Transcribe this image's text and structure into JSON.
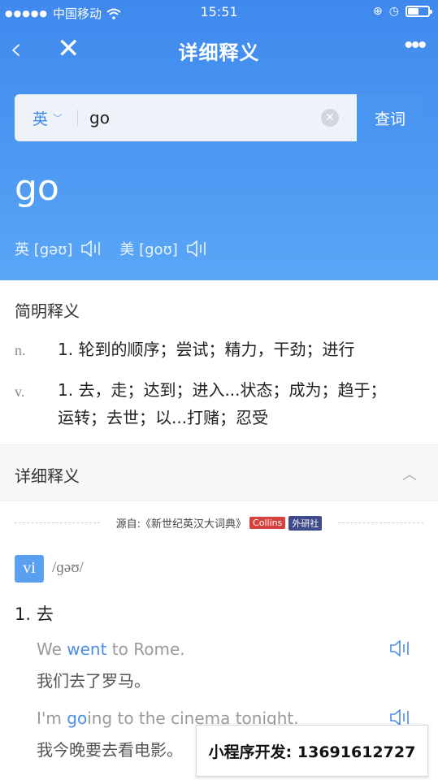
{
  "status_bar": {
    "carrier": "中国移动",
    "time": "15:51",
    "battery_level": 0.55
  },
  "nav": {
    "title": "详细释义",
    "back_icon": "chevron-left-icon",
    "close_icon": "close-icon",
    "more_icon": "more-icon"
  },
  "search": {
    "lang": "英",
    "value": "go",
    "button": "查词"
  },
  "word": {
    "headword": "go",
    "uk_label": "英 [gəʊ]",
    "us_label": "美 [goʊ]"
  },
  "brief": {
    "title": "简明释义",
    "entries": [
      {
        "pos": "n.",
        "text": "1. 轮到的顺序；尝试；精力，干劲；进行"
      },
      {
        "pos": "v.",
        "text": "1. 去，走；达到；进入...状态；成为；趋于；运转；去世；以...打赌；忍受"
      }
    ]
  },
  "detail": {
    "title": "详细释义",
    "source_prefix": "源自:《新世纪英汉大词典》",
    "tag_collins": "Collins",
    "tag_publisher": "外研社",
    "pos": "vi",
    "phonetic": "/ɡəʊ/",
    "sense_1": "1. 去",
    "examples": [
      {
        "en_pre": "We ",
        "en_hl": "went",
        "en_post": " to Rome.",
        "cn": "我们去了罗马。"
      },
      {
        "en_pre": "I'm ",
        "en_hl": "go",
        "en_post": "ing to the cinema tonight.",
        "cn": "我今晚要去看电影。"
      }
    ]
  },
  "watermark": "小程序开发: 13691612727",
  "colors": {
    "accent": "#4a95f0",
    "highlight": "#4b8de8"
  }
}
